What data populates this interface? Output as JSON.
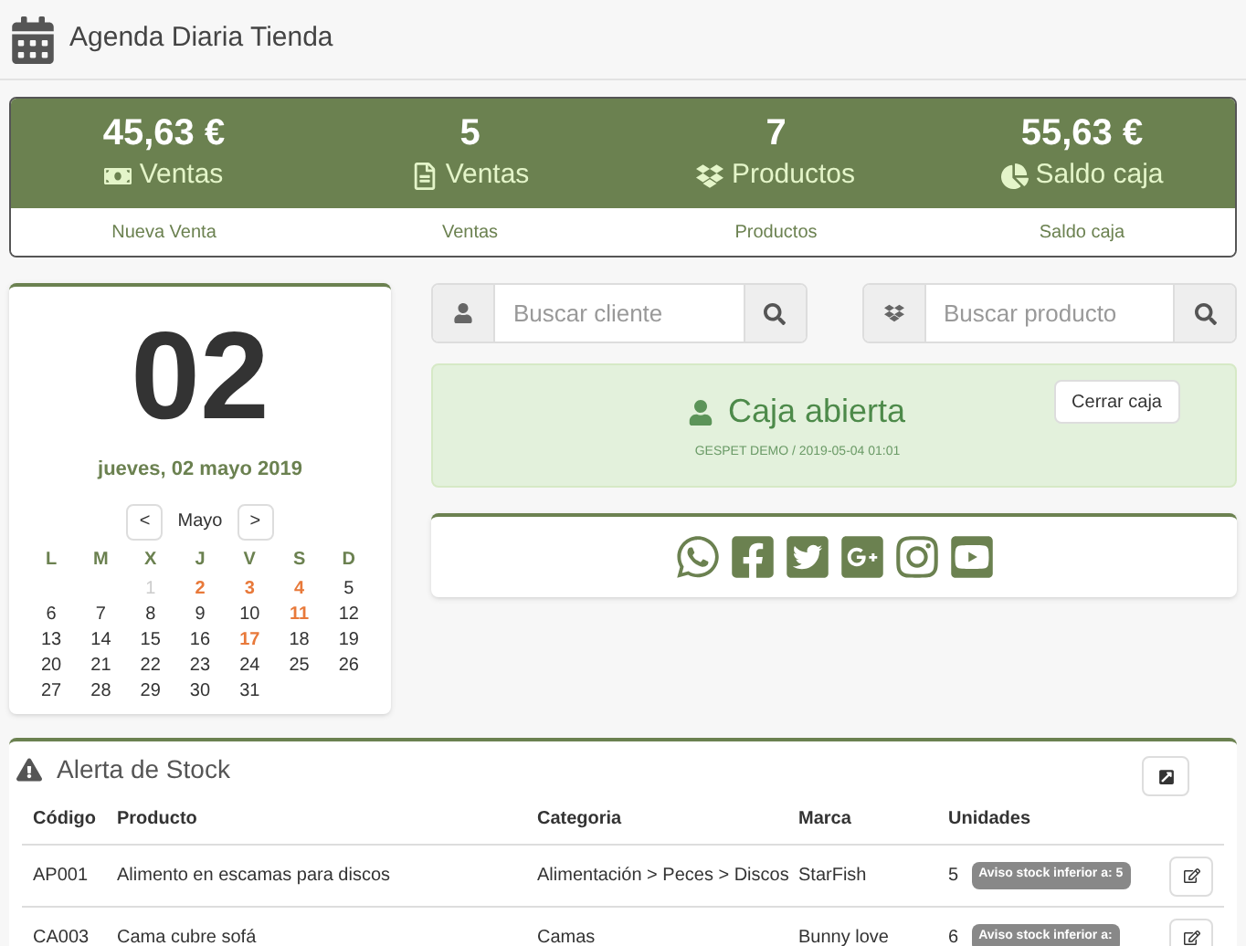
{
  "header": {
    "title": "Agenda Diaria Tienda"
  },
  "stats": [
    {
      "kind": "money",
      "value": "45,63 €",
      "label": "Ventas",
      "link": "Nueva Venta"
    },
    {
      "kind": "file",
      "value": "5",
      "label": "Ventas",
      "link": "Ventas"
    },
    {
      "kind": "box",
      "value": "7",
      "label": "Productos",
      "link": "Productos"
    },
    {
      "kind": "pie",
      "value": "55,63 €",
      "label": "Saldo caja",
      "link": "Saldo caja"
    }
  ],
  "calendar": {
    "day": "02",
    "date": "jueves, 02 mayo 2019",
    "prev": "<",
    "month": "Mayo",
    "next": ">",
    "weekdays": [
      "L",
      "M",
      "X",
      "J",
      "V",
      "S",
      "D"
    ],
    "days": [
      {
        "label": "1",
        "kind": "muted"
      },
      {
        "label": "2",
        "kind": "event"
      },
      {
        "label": "3",
        "kind": "event"
      },
      {
        "label": "4",
        "kind": "event"
      },
      {
        "label": "5",
        "kind": "normal"
      },
      {
        "label": "6",
        "kind": "normal"
      },
      {
        "label": "7",
        "kind": "normal"
      },
      {
        "label": "8",
        "kind": "normal"
      },
      {
        "label": "9",
        "kind": "normal"
      },
      {
        "label": "10",
        "kind": "normal"
      },
      {
        "label": "11",
        "kind": "event"
      },
      {
        "label": "12",
        "kind": "normal"
      },
      {
        "label": "13",
        "kind": "normal"
      },
      {
        "label": "14",
        "kind": "normal"
      },
      {
        "label": "15",
        "kind": "normal"
      },
      {
        "label": "16",
        "kind": "normal"
      },
      {
        "label": "17",
        "kind": "event"
      },
      {
        "label": "18",
        "kind": "normal"
      },
      {
        "label": "19",
        "kind": "normal"
      },
      {
        "label": "20",
        "kind": "normal"
      },
      {
        "label": "21",
        "kind": "normal"
      },
      {
        "label": "22",
        "kind": "normal"
      },
      {
        "label": "23",
        "kind": "normal"
      },
      {
        "label": "24",
        "kind": "normal"
      },
      {
        "label": "25",
        "kind": "normal"
      },
      {
        "label": "26",
        "kind": "normal"
      },
      {
        "label": "27",
        "kind": "normal"
      },
      {
        "label": "28",
        "kind": "normal"
      },
      {
        "label": "29",
        "kind": "normal"
      },
      {
        "label": "30",
        "kind": "normal"
      },
      {
        "label": "31",
        "kind": "normal"
      }
    ]
  },
  "search": [
    {
      "kind": "client",
      "placeholder": "Buscar cliente"
    },
    {
      "kind": "product",
      "placeholder": "Buscar producto"
    }
  ],
  "cash": {
    "title": "Caja abierta",
    "subtitle": "GESPET DEMO / 2019-05-04 01:01",
    "button": "Cerrar caja"
  },
  "stock": {
    "title": "Alerta de Stock",
    "columns": [
      "Código",
      "Producto",
      "Categoria",
      "Marca",
      "Unidades"
    ],
    "rows": [
      {
        "code": "AP001",
        "product": "Alimento en escamas para discos",
        "category": "Alimentación > Peces > Discos",
        "brand": "StarFish",
        "units": "5",
        "alert": "Aviso stock inferior a: 5"
      },
      {
        "code": "CA003",
        "product": "Cama cubre sofá",
        "category": "Camas",
        "brand": "Bunny love",
        "units": "6",
        "alert": "Aviso stock inferior a:"
      }
    ]
  }
}
